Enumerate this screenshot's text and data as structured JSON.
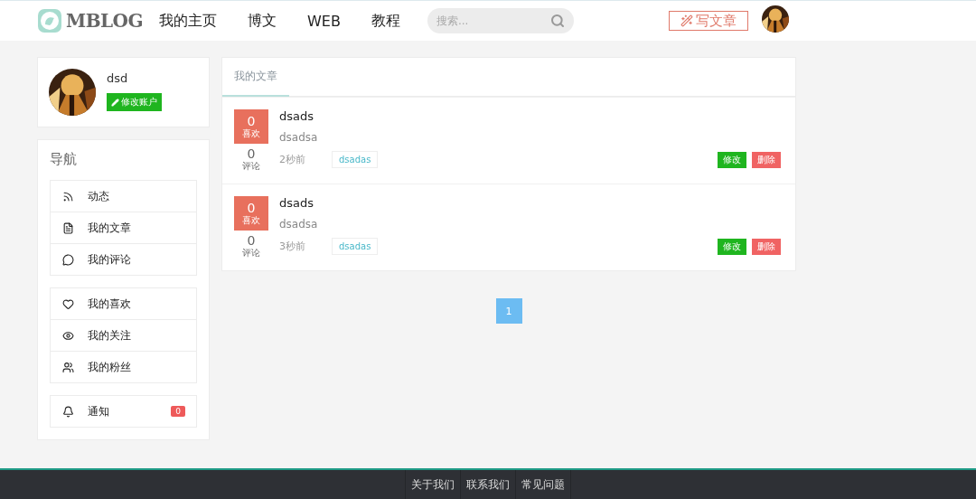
{
  "header": {
    "logo": "MBLOG",
    "nav": [
      {
        "label": "我的主页"
      },
      {
        "label": "博文"
      },
      {
        "label": "WEB"
      },
      {
        "label": "教程"
      }
    ],
    "search": {
      "placeholder": "搜索..."
    },
    "write_button": "写文章"
  },
  "profile": {
    "name": "dsd",
    "edit_button": "修改账户"
  },
  "navigation": {
    "title": "导航",
    "groups": [
      [
        {
          "kind": "feed",
          "label": "动态"
        },
        {
          "kind": "file",
          "label": "我的文章"
        },
        {
          "kind": "comment",
          "label": "我的评论"
        }
      ],
      [
        {
          "kind": "heart",
          "label": "我的喜欢"
        },
        {
          "kind": "eye",
          "label": "我的关注"
        },
        {
          "kind": "users",
          "label": "我的粉丝"
        }
      ],
      [
        {
          "kind": "bell",
          "label": "通知",
          "badge": "0"
        }
      ]
    ]
  },
  "tabs": [
    {
      "label": "我的文章",
      "selected": true
    }
  ],
  "posts": [
    {
      "likes": "0",
      "likes_label": "喜欢",
      "comments": "0",
      "comments_label": "评论",
      "title": "dsads",
      "summary": "dsadsa",
      "time": "2秒前",
      "tag": "dsadas",
      "edit": "修改",
      "delete": "删除"
    },
    {
      "likes": "0",
      "likes_label": "喜欢",
      "comments": "0",
      "comments_label": "评论",
      "title": "dsads",
      "summary": "dsadsa",
      "time": "3秒前",
      "tag": "dsadas",
      "edit": "修改",
      "delete": "删除"
    }
  ],
  "pagination": [
    {
      "label": "1",
      "selected": true
    }
  ],
  "footer": {
    "links": [
      "关于我们",
      "联系我们",
      "常见问题"
    ]
  }
}
